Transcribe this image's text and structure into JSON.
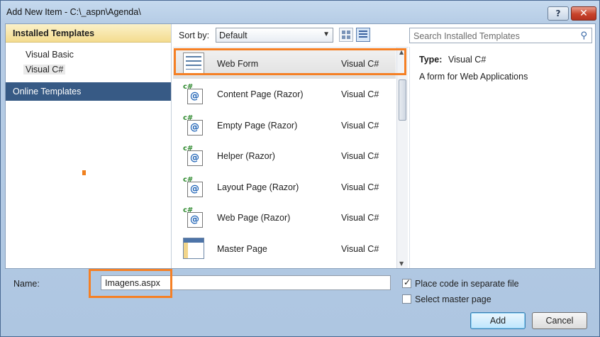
{
  "window": {
    "title": "Add New Item - C:\\_aspn\\Agenda\\",
    "help_label": "?",
    "close_label": "✕"
  },
  "left_pane": {
    "header": "Installed Templates",
    "items": [
      {
        "label": "Visual Basic"
      },
      {
        "label": "Visual C#"
      }
    ],
    "online": "Online Templates"
  },
  "toolbar": {
    "sort_label": "Sort by:",
    "sort_value": "Default",
    "search_placeholder": "Search Installed Templates"
  },
  "templates": [
    {
      "name": "Web Form",
      "lang": "Visual C#",
      "icon": "webform-icon"
    },
    {
      "name": "Content Page (Razor)",
      "lang": "Visual C#",
      "icon": "razor-page-icon"
    },
    {
      "name": "Empty Page (Razor)",
      "lang": "Visual C#",
      "icon": "razor-page-icon"
    },
    {
      "name": "Helper (Razor)",
      "lang": "Visual C#",
      "icon": "razor-page-icon"
    },
    {
      "name": "Layout Page (Razor)",
      "lang": "Visual C#",
      "icon": "razor-page-icon"
    },
    {
      "name": "Web Page (Razor)",
      "lang": "Visual C#",
      "icon": "razor-page-icon"
    },
    {
      "name": "Master Page",
      "lang": "Visual C#",
      "icon": "master-page-icon"
    }
  ],
  "details": {
    "type_label": "Type:",
    "type_value": "Visual C#",
    "description": "A form for Web Applications"
  },
  "bottom": {
    "name_label": "Name:",
    "name_value": "Imagens.aspx",
    "place_code_label": "Place code in separate file",
    "place_code_checked": true,
    "master_label": "Select master page",
    "master_checked": false,
    "add_label": "Add",
    "cancel_label": "Cancel"
  },
  "colors": {
    "highlight": "#f58025",
    "online_bg": "#375a85",
    "header_bg": "#f4dc8f"
  }
}
